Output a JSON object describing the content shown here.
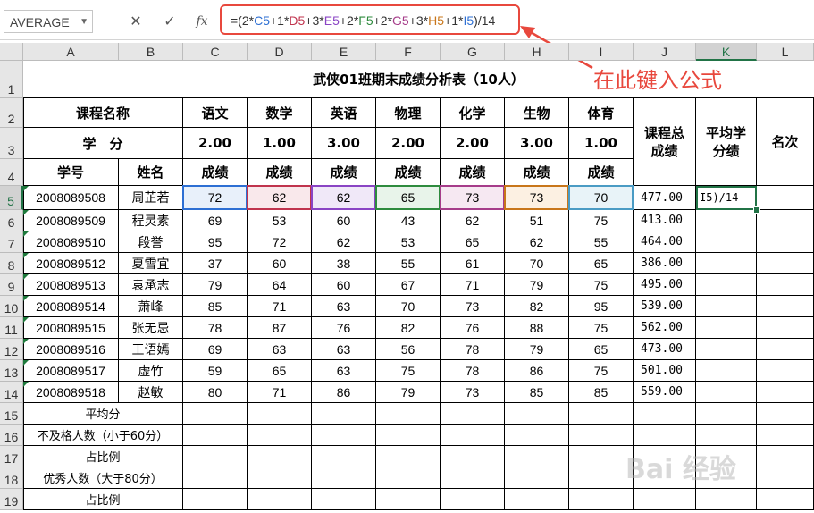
{
  "name_box": "AVERAGE",
  "icons": {
    "cancel": "x-icon",
    "enter": "check-icon",
    "function": "fx-icon",
    "dropdown": "chevron-down-icon"
  },
  "formula_bar": {
    "fx_label": "fx",
    "parts": [
      {
        "t": "=(2*",
        "c": "#333333"
      },
      {
        "t": "C5",
        "c": "#2d6fd3"
      },
      {
        "t": "+1*",
        "c": "#333333"
      },
      {
        "t": "D5",
        "c": "#c0334d"
      },
      {
        "t": "+3*",
        "c": "#333333"
      },
      {
        "t": "E5",
        "c": "#8a44c4"
      },
      {
        "t": "+2*",
        "c": "#333333"
      },
      {
        "t": "F5",
        "c": "#2e8b3e"
      },
      {
        "t": "+2*",
        "c": "#333333"
      },
      {
        "t": "G5",
        "c": "#a63c8a"
      },
      {
        "t": "+3*",
        "c": "#333333"
      },
      {
        "t": "H5",
        "c": "#c8761a"
      },
      {
        "t": "+1*",
        "c": "#333333"
      },
      {
        "t": "I5",
        "c": "#2d6fd3"
      },
      {
        "t": ")/14",
        "c": "#333333"
      }
    ]
  },
  "annotation": {
    "text": "在此键入公式",
    "color": "#e8483d"
  },
  "columns": [
    "A",
    "B",
    "C",
    "D",
    "E",
    "F",
    "G",
    "H",
    "I",
    "J",
    "K",
    "L"
  ],
  "rows": [
    "1",
    "2",
    "3",
    "4",
    "5",
    "6",
    "7",
    "8",
    "9",
    "10",
    "11",
    "12",
    "13",
    "14",
    "15",
    "16",
    "17",
    "18",
    "19"
  ],
  "selected_column": "K",
  "selected_row": "5",
  "sheet": {
    "title": "武侠01班期末成绩分析表（10人）",
    "course_name_label": "课程名称",
    "credit_label": "学　分",
    "student_id_label": "学号",
    "name_label": "姓名",
    "subjects": [
      "语文",
      "数学",
      "英语",
      "物理",
      "化学",
      "生物",
      "体育"
    ],
    "credits": [
      "2.00",
      "1.00",
      "3.00",
      "2.00",
      "2.00",
      "3.00",
      "1.00"
    ],
    "score_label": "成绩",
    "total_label": "课程总成绩",
    "avg_label": "平均学分绩",
    "rank_label": "名次",
    "students": [
      {
        "id": "2008089508",
        "name": "周芷若",
        "scores": [
          "72",
          "62",
          "62",
          "65",
          "73",
          "73",
          "70"
        ],
        "total": "477.00"
      },
      {
        "id": "2008089509",
        "name": "程灵素",
        "scores": [
          "69",
          "53",
          "60",
          "43",
          "62",
          "51",
          "75"
        ],
        "total": "413.00"
      },
      {
        "id": "2008089510",
        "name": "段誉",
        "scores": [
          "95",
          "72",
          "62",
          "53",
          "65",
          "62",
          "55"
        ],
        "total": "464.00"
      },
      {
        "id": "2008089512",
        "name": "夏雪宜",
        "scores": [
          "37",
          "60",
          "38",
          "55",
          "61",
          "70",
          "65"
        ],
        "total": "386.00"
      },
      {
        "id": "2008089513",
        "name": "袁承志",
        "scores": [
          "79",
          "64",
          "60",
          "67",
          "71",
          "79",
          "75"
        ],
        "total": "495.00"
      },
      {
        "id": "2008089514",
        "name": "萧峰",
        "scores": [
          "85",
          "71",
          "63",
          "70",
          "73",
          "82",
          "95"
        ],
        "total": "539.00"
      },
      {
        "id": "2008089515",
        "name": "张无忌",
        "scores": [
          "78",
          "87",
          "76",
          "82",
          "76",
          "88",
          "75"
        ],
        "total": "562.00"
      },
      {
        "id": "2008089516",
        "name": "王语嫣",
        "scores": [
          "69",
          "63",
          "63",
          "56",
          "78",
          "79",
          "65"
        ],
        "total": "473.00"
      },
      {
        "id": "2008089517",
        "name": "虚竹",
        "scores": [
          "59",
          "65",
          "63",
          "75",
          "78",
          "86",
          "75"
        ],
        "total": "501.00"
      },
      {
        "id": "2008089518",
        "name": "赵敏",
        "scores": [
          "80",
          "71",
          "86",
          "79",
          "73",
          "85",
          "85"
        ],
        "total": "559.00"
      }
    ],
    "summary_labels": [
      "平均分",
      "不及格人数（小于60分）",
      "占比例",
      "优秀人数（大于80分）",
      "占比例"
    ],
    "active_cell_text": "I5)/14",
    "ref_colors": [
      "#2d6fd3",
      "#c0334d",
      "#8a44c4",
      "#2e8b3e",
      "#a63c8a",
      "#c8761a",
      "#4a9bc4"
    ],
    "ref_fills": [
      "#e8f0fa",
      "#f9e8eb",
      "#f0e8f8",
      "#e8f4ea",
      "#f6e8f2",
      "#fcf0e2",
      "#e8f3f8"
    ]
  },
  "watermark": "Bai 经验"
}
